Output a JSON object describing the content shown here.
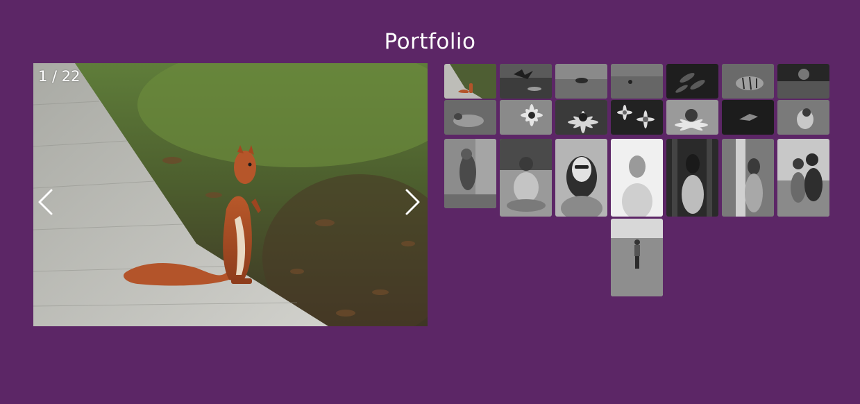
{
  "page": {
    "title": "Portfolio"
  },
  "viewer": {
    "counter": "1 / 22",
    "prev_icon": "chevron-left-icon",
    "next_icon": "chevron-right-icon",
    "current_photo": "red squirrel standing on boardwalk"
  },
  "thumbnails": [
    {
      "name": "squirrel-boardwalk",
      "selected": true
    },
    {
      "name": "duck-landing-water"
    },
    {
      "name": "squirrel-grass"
    },
    {
      "name": "bird-in-grass"
    },
    {
      "name": "fern-leaves"
    },
    {
      "name": "tiger"
    },
    {
      "name": "cat-in-basket"
    },
    {
      "name": "chipmunk"
    },
    {
      "name": "daisies"
    },
    {
      "name": "coneflower"
    },
    {
      "name": "daisy-pair"
    },
    {
      "name": "coneflower-closeup"
    },
    {
      "name": "bird-flying"
    },
    {
      "name": "bird-perched"
    },
    {
      "name": "parrot-portrait"
    },
    {
      "name": "woman-sitting-field"
    },
    {
      "name": "woman-glasses-portrait"
    },
    {
      "name": "woman-bright-portrait"
    },
    {
      "name": "woman-forest"
    },
    {
      "name": "woman-birch-tree"
    },
    {
      "name": "couple-portrait"
    },
    {
      "name": "woman-tall-grass"
    }
  ],
  "colors": {
    "background": "#5c2666",
    "text": "#ffffff"
  }
}
